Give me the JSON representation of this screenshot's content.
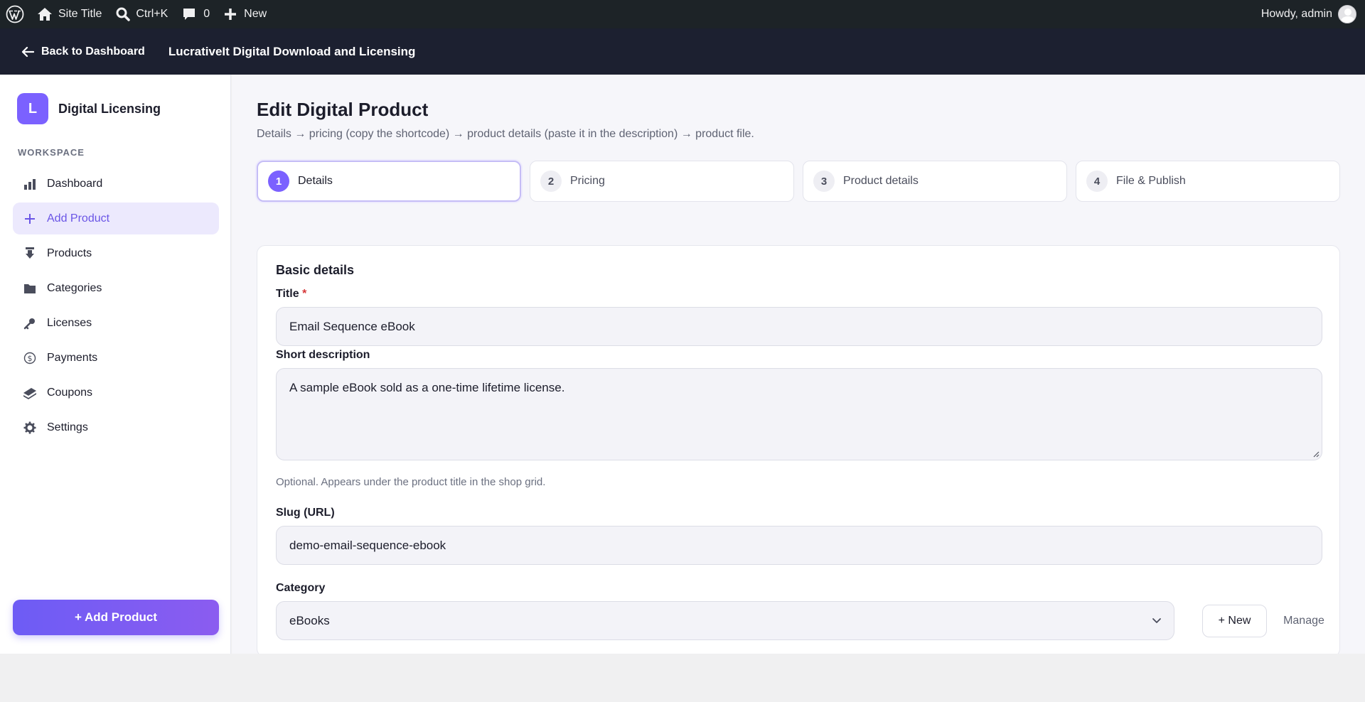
{
  "admin_bar": {
    "site_title": "Site Title",
    "search_shortcut": "Ctrl+K",
    "comments_count": "0",
    "new_label": "New",
    "howdy": "Howdy, admin"
  },
  "plugin_header": {
    "back_label": "Back to Dashboard",
    "plugin_name": "LucrativeIt Digital Download and Licensing"
  },
  "sidebar": {
    "brand_initial": "L",
    "brand_name": "Digital Licensing",
    "section_label": "WORKSPACE",
    "items": [
      {
        "label": "Dashboard",
        "icon": "bar-chart-icon"
      },
      {
        "label": "Add Product",
        "icon": "plus-icon",
        "active": true
      },
      {
        "label": "Products",
        "icon": "download-icon"
      },
      {
        "label": "Categories",
        "icon": "folder-icon"
      },
      {
        "label": "Licenses",
        "icon": "key-icon"
      },
      {
        "label": "Payments",
        "icon": "dollar-icon"
      },
      {
        "label": "Coupons",
        "icon": "coupon-icon"
      },
      {
        "label": "Settings",
        "icon": "gear-icon"
      }
    ],
    "add_button": "+ Add Product"
  },
  "main": {
    "title": "Edit Digital Product",
    "subtitle": "Details → pricing (copy the shortcode) → product details (paste it in the description) → product file.",
    "steps": [
      {
        "num": "1",
        "label": "Details",
        "active": true
      },
      {
        "num": "2",
        "label": "Pricing"
      },
      {
        "num": "3",
        "label": "Product details"
      },
      {
        "num": "4",
        "label": "File & Publish"
      }
    ],
    "card": {
      "title": "Basic details",
      "title_field": {
        "label": "Title",
        "required_mark": "*",
        "value": "Email Sequence eBook"
      },
      "short_desc": {
        "label": "Short description",
        "value": "A sample eBook sold as a one-time lifetime license.",
        "help": "Optional. Appears under the product title in the shop grid."
      },
      "slug": {
        "label": "Slug (URL)",
        "value": "demo-email-sequence-ebook"
      },
      "category": {
        "label": "Category",
        "value": "eBooks",
        "new_button": "+ New",
        "manage_button": "Manage"
      }
    }
  },
  "colors": {
    "accent": "#7b61ff",
    "admin_bar": "#1d2327",
    "plugin_header": "#1c2030",
    "required": "#d63638"
  }
}
